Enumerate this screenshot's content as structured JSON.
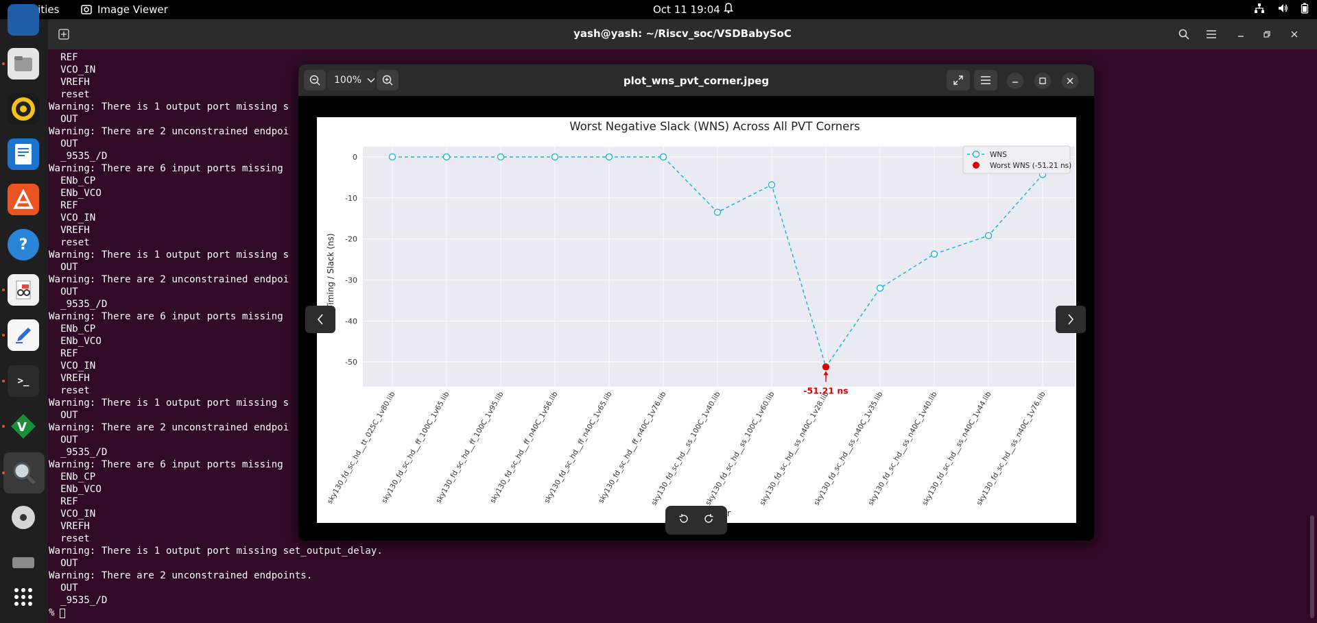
{
  "topbar": {
    "activities": "Activities",
    "app_name": "Image Viewer",
    "datetime": "Oct 11  19:04"
  },
  "terminal": {
    "title": "yash@yash: ~/Riscv_soc/VSDBabySoC",
    "lines": [
      "  REF",
      "  VCO_IN",
      "  VREFH",
      "  reset",
      "Warning: There is 1 output port missing s",
      "  OUT",
      "Warning: There are 2 unconstrained endpoi",
      "  OUT",
      "  _9535_/D",
      "Warning: There are 6 input ports missing ",
      "  ENb_CP",
      "  ENb_VCO",
      "  REF",
      "  VCO_IN",
      "  VREFH",
      "  reset",
      "Warning: There is 1 output port missing s",
      "  OUT",
      "Warning: There are 2 unconstrained endpoi",
      "  OUT",
      "  _9535_/D",
      "Warning: There are 6 input ports missing ",
      "  ENb_CP",
      "  ENb_VCO",
      "  REF",
      "  VCO_IN",
      "  VREFH",
      "  reset",
      "Warning: There is 1 output port missing s",
      "  OUT",
      "Warning: There are 2 unconstrained endpoi",
      "  OUT",
      "  _9535_/D",
      "Warning: There are 6 input ports missing ",
      "  ENb_CP",
      "  ENb_VCO",
      "  REF",
      "  VCO_IN",
      "  VREFH",
      "  reset",
      "Warning: There is 1 output port missing set_output_delay.",
      "  OUT",
      "Warning: There are 2 unconstrained endpoints.",
      "  OUT",
      "  _9535_/D",
      "% "
    ]
  },
  "viewer": {
    "zoom": "100%",
    "filename": "plot_wns_pvt_corner.jpeg"
  },
  "chart_data": {
    "type": "line",
    "title": "Worst Negative Slack (WNS) Across All PVT Corners",
    "ylabel": "Timing / Slack (ns)",
    "xlabel": "orner",
    "categories": [
      "sky130_fd_sc_hd__tt_025C_1v80.lib",
      "sky130_fd_sc_hd__ff_100C_1v65.lib",
      "sky130_fd_sc_hd__ff_100C_1v95.lib",
      "sky130_fd_sc_hd__ff_n40C_1v56.lib",
      "sky130_fd_sc_hd__ff_n40C_1v65.lib",
      "sky130_fd_sc_hd__ff_n40C_1v76.lib",
      "sky130_fd_sc_hd__ss_100C_1v40.lib",
      "sky130_fd_sc_hd__ss_100C_1v60.lib",
      "sky130_fd_sc_hd__ss_n40C_1v28.lib",
      "sky130_fd_sc_hd__ss_n40C_1v35.lib",
      "sky130_fd_sc_hd__ss_n40C_1v40.lib",
      "sky130_fd_sc_hd__ss_n40C_1v44.lib",
      "sky130_fd_sc_hd__ss_n40C_1v76.lib"
    ],
    "series": [
      {
        "name": "WNS",
        "values": [
          0,
          0,
          0,
          0,
          0,
          0,
          -13.5,
          -6.8,
          -51.21,
          -32.0,
          -23.7,
          -19.2,
          -4.3
        ],
        "color": "#1fb4d8"
      }
    ],
    "highlight": {
      "name": "Worst WNS (-51.21 ns)",
      "index": 8,
      "value": -51.21,
      "label": "-51.21 ns",
      "color": "#e00000"
    },
    "yticks": [
      0,
      -10,
      -20,
      -30,
      -40,
      -50
    ],
    "ylim": [
      -56,
      2.5
    ],
    "grid": true,
    "legend_position": "top-right"
  }
}
